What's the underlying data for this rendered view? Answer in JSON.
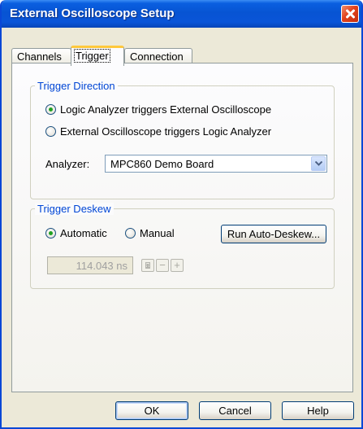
{
  "window": {
    "title": "External Oscilloscope Setup"
  },
  "tabs": [
    {
      "label": "Channels"
    },
    {
      "label": "Trigger"
    },
    {
      "label": "Connection"
    }
  ],
  "trigger_direction": {
    "legend": "Trigger Direction",
    "option_1": "Logic Analyzer triggers External Oscilloscope",
    "option_2": "External Oscilloscope triggers Logic Analyzer",
    "selected": "option_1",
    "analyzer_label": "Analyzer:",
    "analyzer_value": "MPC860 Demo Board"
  },
  "trigger_deskew": {
    "legend": "Trigger Deskew",
    "automatic_label": "Automatic",
    "manual_label": "Manual",
    "selected": "automatic",
    "run_button": "Run Auto-Deskew...",
    "deskew_value": "114.043 ns"
  },
  "buttons": {
    "ok": "OK",
    "cancel": "Cancel",
    "help": "Help"
  }
}
